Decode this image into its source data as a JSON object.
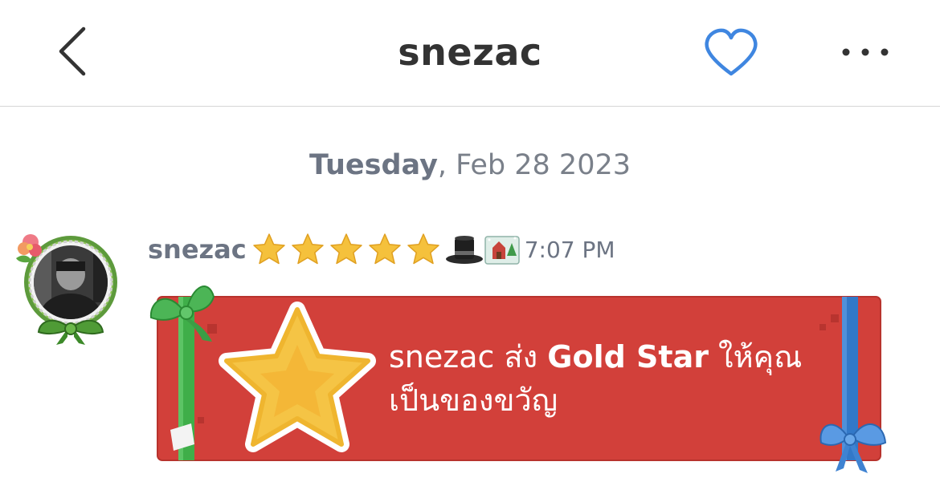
{
  "header": {
    "title": "snezac",
    "back_icon": "chevron-left-icon",
    "favorite_icon": "heart-outline-icon",
    "more_icon": "ellipsis-horizontal-icon",
    "accent_color": "#3f86e0"
  },
  "date_separator": {
    "day": "Tuesday",
    "rest": ", Feb 28 2023"
  },
  "message": {
    "username": "snezac",
    "star_count": 5,
    "badges": [
      "gold-star-icon",
      "top-hat-icon",
      "christmas-card-icon"
    ],
    "time": "7:07 PM",
    "gift": {
      "sender": "snezac",
      "verb": " ส่ง ",
      "item_name": "Gold Star",
      "suffix": " ให้คุณ",
      "line2": "เป็นของขวัญ",
      "background_color": "#d2403a",
      "left_ribbon_color": "#3fae49",
      "right_ribbon_color": "#3278c8",
      "star_color": "#f5c445"
    }
  }
}
